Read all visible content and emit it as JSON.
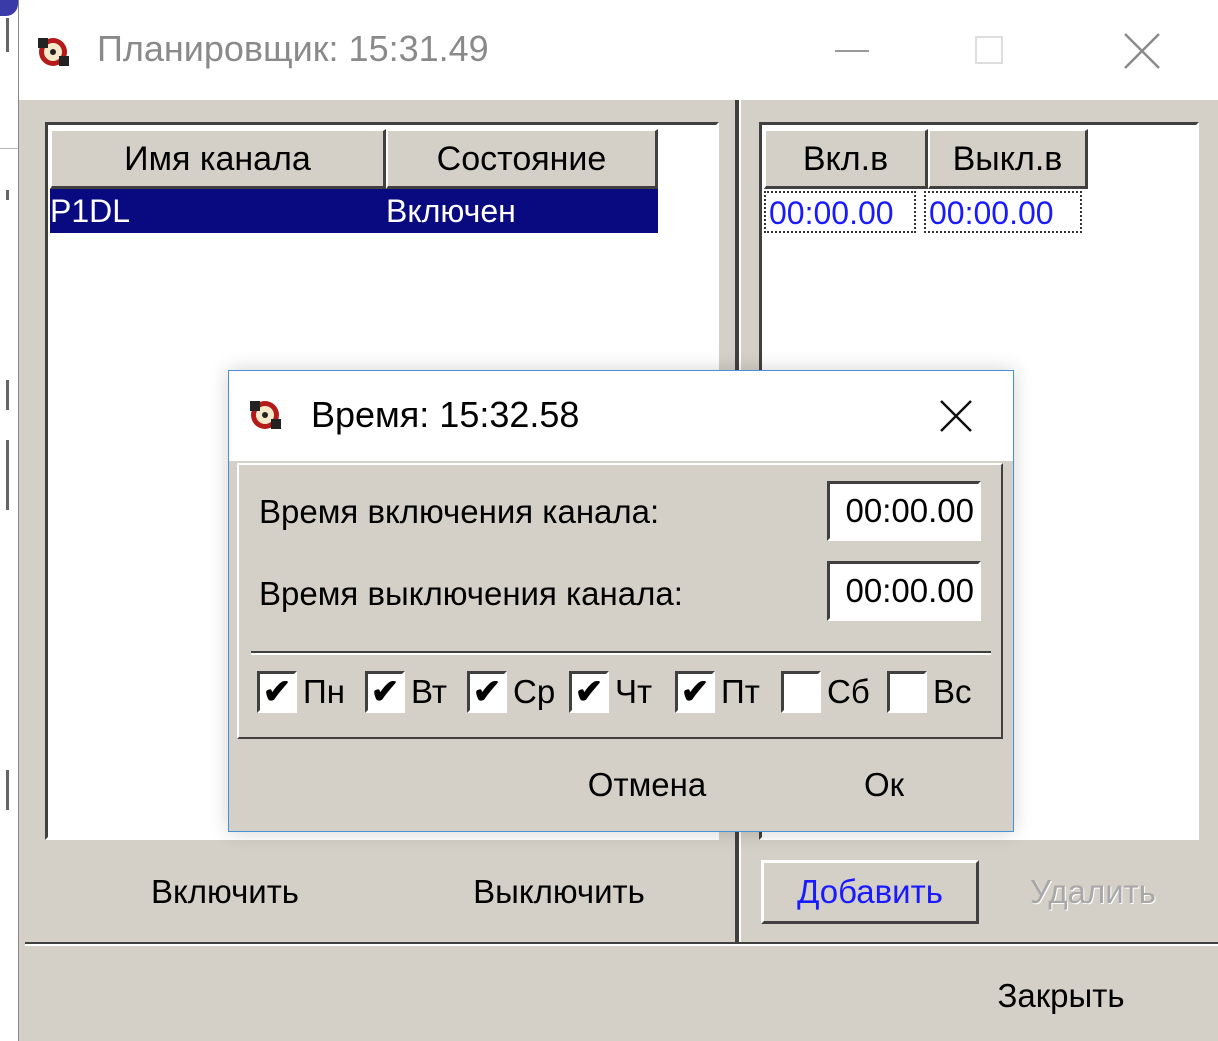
{
  "main_window": {
    "title": "Планировщик: 15:31.49"
  },
  "channels_table": {
    "headers": [
      "Имя канала",
      "Состояние"
    ],
    "rows": [
      {
        "name": "P1DL",
        "state": "Включен"
      }
    ]
  },
  "schedule_table": {
    "headers": [
      "Вкл.в",
      "Выкл.в"
    ],
    "rows": [
      {
        "on": "00:00.00",
        "off": "00:00.00"
      }
    ]
  },
  "buttons": {
    "enable": "Включить",
    "disable": "Выключить",
    "add": "Добавить",
    "delete": "Удалить",
    "close": "Закрыть"
  },
  "time_dialog": {
    "title": "Время: 15:32.58",
    "on_label": "Время включения канала:",
    "on_value": "00:00.00",
    "off_label": "Время выключения канала:",
    "off_value": "00:00.00",
    "days": [
      {
        "label": "Пн",
        "checked": true
      },
      {
        "label": "Вт",
        "checked": true
      },
      {
        "label": "Ср",
        "checked": true
      },
      {
        "label": "Чт",
        "checked": true
      },
      {
        "label": "Пт",
        "checked": true
      },
      {
        "label": "Сб",
        "checked": false
      },
      {
        "label": "Вс",
        "checked": false
      }
    ],
    "cancel": "Отмена",
    "ok": "Ок"
  },
  "colors": {
    "face": "#d4d0c8",
    "selection": "#0a0a80",
    "link_blue": "#1a1aff"
  }
}
